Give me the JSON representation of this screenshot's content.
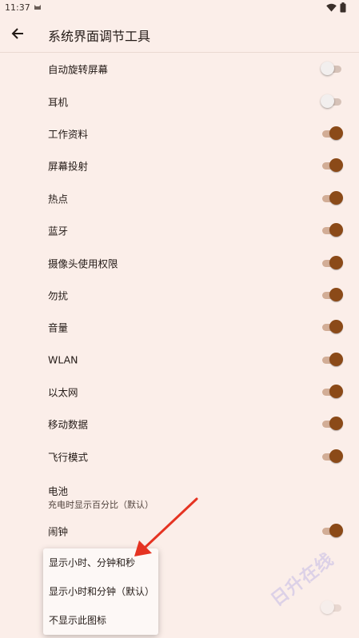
{
  "status_bar": {
    "time": "11:37",
    "icons": [
      "cat-icon",
      "wifi-icon",
      "battery-icon"
    ]
  },
  "app_bar": {
    "title": "系统界面调节工具",
    "back_icon": "arrow-left-icon"
  },
  "settings": [
    {
      "label": "自动旋转屏幕",
      "on": false
    },
    {
      "label": "耳机",
      "on": false
    },
    {
      "label": "工作资料",
      "on": true
    },
    {
      "label": "屏幕投射",
      "on": true
    },
    {
      "label": "热点",
      "on": true
    },
    {
      "label": "蓝牙",
      "on": true
    },
    {
      "label": "摄像头使用权限",
      "on": true
    },
    {
      "label": "勿扰",
      "on": true
    },
    {
      "label": "音量",
      "on": true
    },
    {
      "label": "WLAN",
      "on": true
    },
    {
      "label": "以太网",
      "on": true
    },
    {
      "label": "移动数据",
      "on": true
    },
    {
      "label": "飞行模式",
      "on": true
    }
  ],
  "battery": {
    "label": "电池",
    "sub": "充电时显示百分比（默认）"
  },
  "alarm": {
    "label": "闹钟",
    "on": true
  },
  "popup": {
    "options": [
      "显示小时、分钟和秒",
      "显示小时和分钟（默认）",
      "不显示此图标"
    ]
  },
  "watermark": "日升在线",
  "colors": {
    "background": "#FBEEE9",
    "accent": "#8B4A18",
    "arrow": "#E53322"
  }
}
